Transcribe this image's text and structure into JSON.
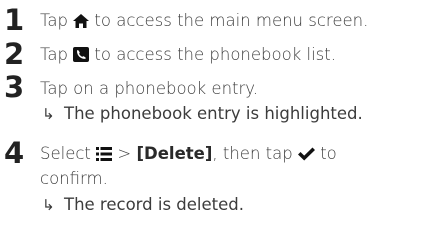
{
  "steps": [
    {
      "number": "1",
      "before": "Tap ",
      "icon": "home-icon",
      "after": " to access the main menu screen."
    },
    {
      "number": "2",
      "before": "Tap ",
      "icon": "phonebook-icon",
      "after": " to access the phonebook list."
    },
    {
      "number": "3",
      "text": "Tap on a phonebook entry.",
      "result": "The phonebook entry is highlighted."
    },
    {
      "number": "4",
      "before": "Select ",
      "icon": "menu-icon",
      "mid1": " > ",
      "option": "[Delete]",
      "mid2": ", then tap ",
      "icon2": "checkmark-icon",
      "after": " to",
      "line2": "confirm.",
      "result": "The record is deleted."
    }
  ],
  "result_arrow": "↳"
}
